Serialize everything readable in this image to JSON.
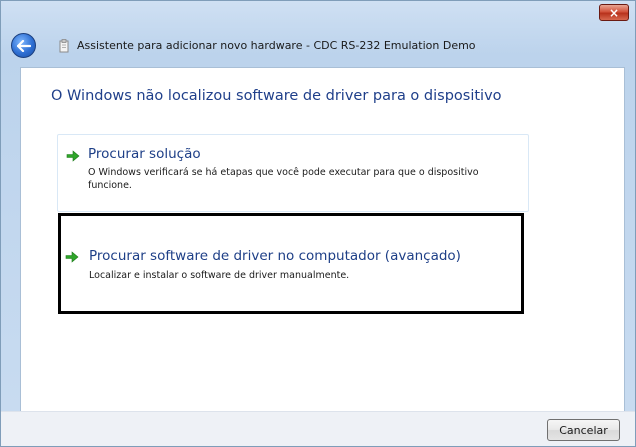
{
  "window": {
    "title": "Assistente para adicionar novo hardware - CDC RS-232 Emulation Demo",
    "close_label": "×"
  },
  "main": {
    "headline": "O Windows não localizou software de driver para o dispositivo",
    "options": [
      {
        "title": "Procurar solução",
        "description": "O Windows verificará se há etapas que você pode executar para que o dispositivo funcione."
      },
      {
        "title": "Procurar software de driver no computador (avançado)",
        "description": "Localizar e instalar o software de driver manualmente."
      }
    ]
  },
  "footer": {
    "cancel_label": "Cancelar"
  },
  "icons": {
    "back": "back-arrow-icon",
    "hardware": "hardware-icon",
    "option_arrow": "green-arrow-icon",
    "close": "close-icon"
  },
  "colors": {
    "headline": "#1f3f8a",
    "option_title": "#1e3f87",
    "arrow": "#2fa52a",
    "close_button": "#c8432b",
    "frame": "#c9dcf1"
  }
}
